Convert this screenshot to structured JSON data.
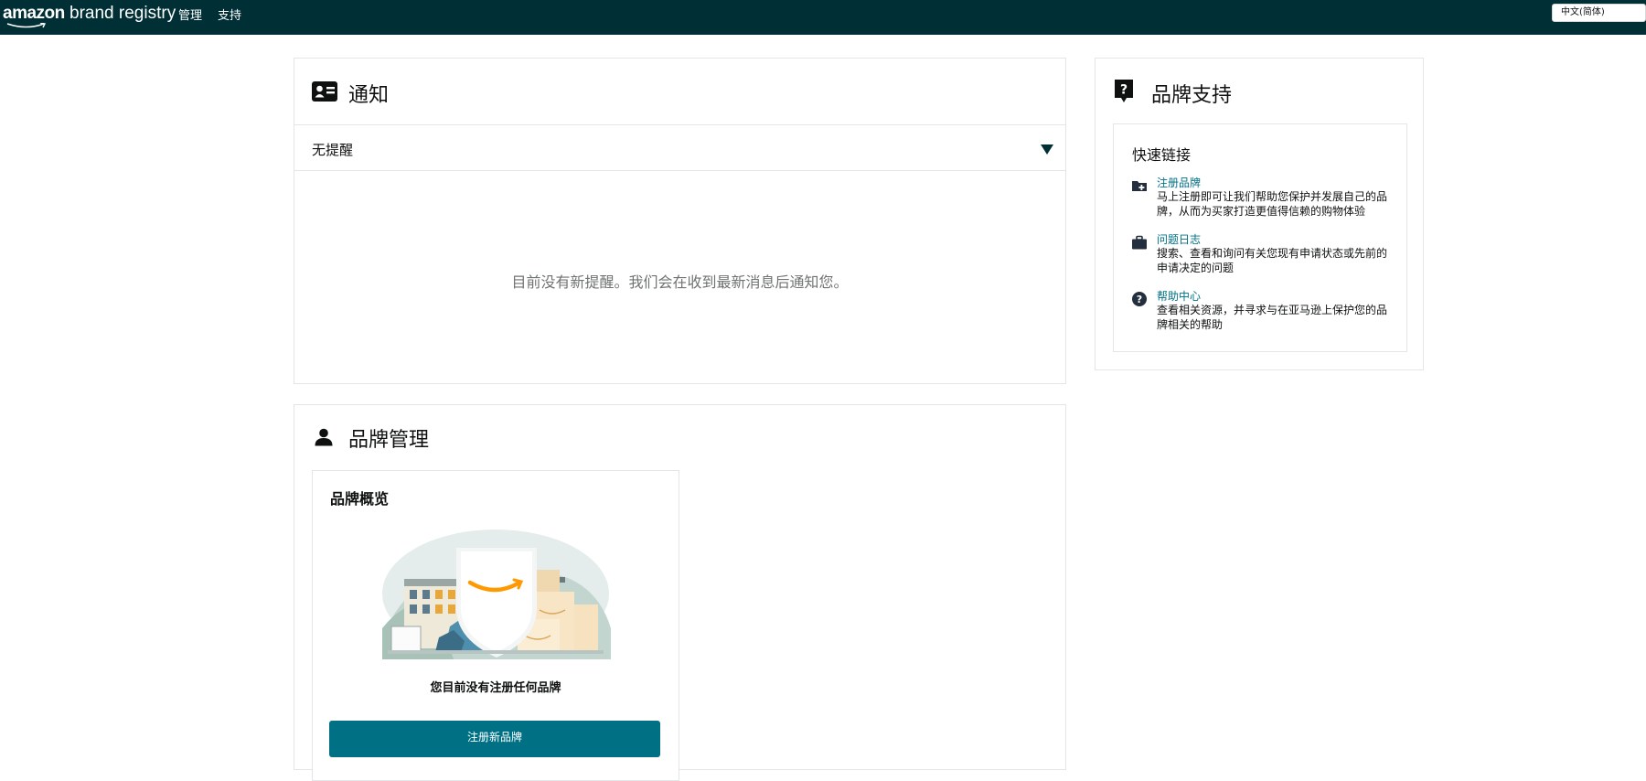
{
  "header": {
    "logo_brand": "amazon",
    "logo_product": "brand registry",
    "nav": [
      {
        "label": "管理"
      },
      {
        "label": "支持"
      }
    ],
    "language": "中文(简体)"
  },
  "notifications": {
    "title": "通知",
    "filter_label": "无提醒",
    "empty_message": "目前没有新提醒。我们会在收到最新消息后通知您。"
  },
  "brand_management": {
    "title": "品牌管理",
    "overview": {
      "title": "品牌概览",
      "no_brand_text": "您目前没有注册任何品牌",
      "register_button": "注册新品牌"
    }
  },
  "brand_support": {
    "title": "品牌支持",
    "quick_links_title": "快速链接",
    "links": [
      {
        "icon": "folder-plus-icon",
        "label": "注册品牌",
        "description": "马上注册即可让我们帮助您保护并发展自己的品牌，从而为买家打造更值得信赖的购物体验"
      },
      {
        "icon": "briefcase-icon",
        "label": "问题日志",
        "description": "搜索、查看和询问有关您现有申请状态或先前的申请决定的问题"
      },
      {
        "icon": "help-circle-icon",
        "label": "帮助中心",
        "description": "查看相关资源，并寻求与在亚马逊上保护您的品牌相关的帮助"
      }
    ]
  },
  "colors": {
    "header_bg": "#002f36",
    "link": "#007185",
    "button": "#007185",
    "smile": "#ff9900"
  }
}
